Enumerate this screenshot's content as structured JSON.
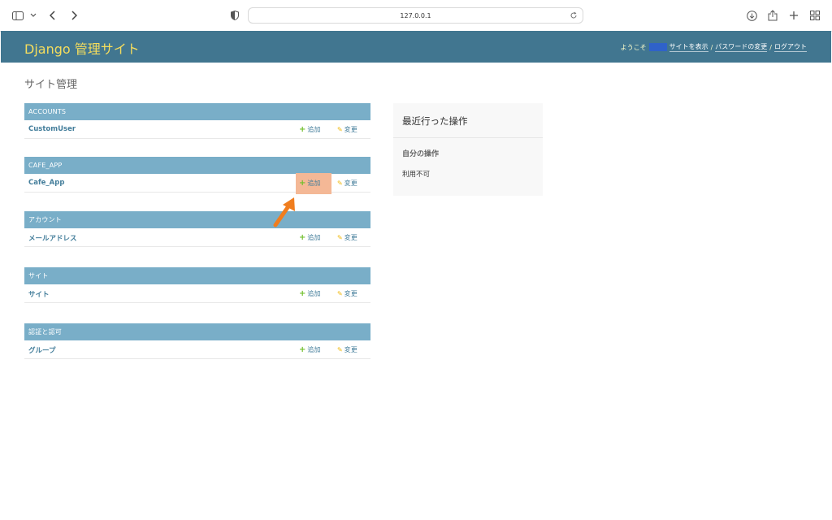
{
  "browser": {
    "url": "127.0.0.1",
    "icons": [
      "sidebar-icon",
      "chevron-down-icon",
      "back-icon",
      "forward-icon",
      "shield-icon",
      "reload-icon",
      "download-icon",
      "share-icon",
      "new-tab-icon",
      "tab-overview-icon"
    ]
  },
  "header": {
    "brand": "Django 管理サイト",
    "welcome": "ようこそ",
    "view_site": "サイトを表示",
    "separator": "/",
    "change_password": "パスワードの変更",
    "logout": "ログアウト",
    "brand_color": "#f5dd5d",
    "bar_color": "#417690"
  },
  "page_title": "サイト管理",
  "modules": [
    {
      "caption": "ACCOUNTS",
      "model": "CustomUser",
      "add": "追加",
      "change": "変更"
    },
    {
      "caption": "CAFE_APP",
      "model": "Cafe_App",
      "add": "追加",
      "change": "変更"
    },
    {
      "caption": "アカウント",
      "model": "メールアドレス",
      "add": "追加",
      "change": "変更"
    },
    {
      "caption": "サイト",
      "model": "サイト",
      "add": "追加",
      "change": "変更"
    },
    {
      "caption": "認証と認可",
      "model": "グループ",
      "add": "追加",
      "change": "変更"
    }
  ],
  "recent_actions": {
    "title": "最近行った操作",
    "subtitle": "自分の操作",
    "empty": "利用不可"
  },
  "colors": {
    "module_caption": "#79aec8",
    "link": "#447e9b",
    "highlight": "#f4b896",
    "arrow": "#f07d1e"
  }
}
